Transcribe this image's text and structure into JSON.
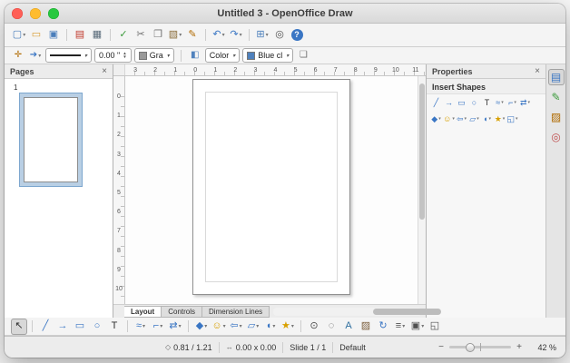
{
  "window": {
    "title": "Untitled 3 - OpenOffice Draw"
  },
  "chrome": {
    "dropdown_glyph": "▾",
    "spin_up": "▲",
    "spin_down": "▼"
  },
  "colors": {
    "accent": "#3a76c4",
    "selection": "#b9cfe4"
  },
  "standard_toolbar": {
    "group1": [
      {
        "name": "new-document-icon",
        "glyph": "▢",
        "color": "#4a7ebb",
        "dropdown": true
      },
      {
        "name": "open-icon",
        "glyph": "▭",
        "color": "#d89b2e"
      },
      {
        "name": "save-icon",
        "glyph": "▣",
        "color": "#4a7ebb"
      }
    ],
    "group2": [
      {
        "name": "export-pdf-icon",
        "glyph": "▤",
        "color": "#c0392b"
      },
      {
        "name": "print-icon",
        "glyph": "▦",
        "color": "#5a6b7a"
      }
    ],
    "group3": [
      {
        "name": "spelling-icon",
        "glyph": "✓",
        "color": "#3a9a3a"
      },
      {
        "name": "cut-icon",
        "glyph": "✂",
        "color": "#707070"
      },
      {
        "name": "copy-icon",
        "glyph": "❐",
        "color": "#707070"
      },
      {
        "name": "paste-icon",
        "glyph": "▧",
        "color": "#8a6d3b",
        "dropdown": true
      },
      {
        "name": "format-paintbrush-icon",
        "glyph": "✎",
        "color": "#b06a00"
      }
    ],
    "group4": [
      {
        "name": "undo-icon",
        "glyph": "↶",
        "color": "#3a76c4",
        "dropdown": true
      },
      {
        "name": "redo-icon",
        "glyph": "↷",
        "color": "#3a76c4",
        "dropdown": true
      }
    ],
    "group5": [
      {
        "name": "insert-table-icon",
        "glyph": "⊞",
        "color": "#4a7ebb",
        "dropdown": true
      },
      {
        "name": "zoom-icon",
        "glyph": "◎",
        "color": "#505050"
      },
      {
        "name": "help-icon",
        "glyph": "?",
        "color": "#ffffff",
        "cls": "help"
      }
    ]
  },
  "line_filling_toolbar": {
    "edit_points_glyph": "✛",
    "arrow_style_glyph": "➔",
    "line_width": "0.00 \"",
    "line_color_label": "Gra",
    "line_color_swatch": "#9a9a9a",
    "area_fill_glyph": "◧",
    "area_style_label": "Color",
    "area_color_label": "Blue cl",
    "area_color_swatch": "#4f81bd",
    "shadow_glyph": "❏"
  },
  "pages_panel": {
    "title": "Pages",
    "close": "×",
    "page_number": "1"
  },
  "rulers": {
    "horizontal": [
      "3",
      "2",
      "1",
      "0",
      "1",
      "2",
      "3",
      "4",
      "5",
      "6",
      "7",
      "8",
      "9",
      "10",
      "11"
    ],
    "vertical": [
      "0",
      "1",
      "2",
      "3",
      "4",
      "5",
      "6",
      "7",
      "8",
      "9",
      "10"
    ]
  },
  "layer_tabs": [
    {
      "label": "Layout",
      "cls": "active"
    },
    {
      "label": "Controls"
    },
    {
      "label": "Dimension Lines"
    }
  ],
  "properties_panel": {
    "title": "Properties",
    "close": "×",
    "insert_shapes": {
      "title": "Insert Shapes",
      "row1": [
        {
          "name": "line-icon",
          "glyph": "╱",
          "color": "#3a76c4"
        },
        {
          "name": "arrow-icon",
          "glyph": "→",
          "color": "#3a76c4"
        },
        {
          "name": "rectangle-icon",
          "glyph": "▭",
          "color": "#3a76c4"
        },
        {
          "name": "ellipse-icon",
          "glyph": "○",
          "color": "#3a76c4"
        },
        {
          "name": "text-box-icon",
          "glyph": "T",
          "color": "#303030"
        },
        {
          "name": "curve-icon",
          "glyph": "≈",
          "color": "#3a76c4",
          "dropdown": true
        },
        {
          "name": "connector-icon",
          "glyph": "⌐",
          "color": "#3a76c4",
          "dropdown": true
        },
        {
          "name": "lines-arrows-icon",
          "glyph": "⇄",
          "color": "#3a76c4",
          "dropdown": true
        }
      ],
      "row2": [
        {
          "name": "basic-shapes-icon",
          "glyph": "◆",
          "color": "#3a76c4",
          "dropdown": true
        },
        {
          "name": "symbol-shapes-icon",
          "glyph": "☺",
          "color": "#d8a000",
          "dropdown": true
        },
        {
          "name": "block-arrows-icon",
          "glyph": "⇦",
          "color": "#3a76c4",
          "dropdown": true
        },
        {
          "name": "flowchart-icon",
          "glyph": "▱",
          "color": "#3a76c4",
          "dropdown": true
        },
        {
          "name": "callouts-icon",
          "glyph": "◖",
          "color": "#3a76c4",
          "dropdown": true
        },
        {
          "name": "stars-icon",
          "glyph": "★",
          "color": "#d8a000",
          "dropdown": true
        },
        {
          "name": "3d-objects-icon",
          "glyph": "◱",
          "color": "#3a76c4",
          "dropdown": true
        }
      ]
    }
  },
  "sidebar_deck": [
    {
      "name": "properties-deck-icon",
      "glyph": "▤",
      "color": "#3a76c4",
      "cls": "active"
    },
    {
      "name": "styles-deck-icon",
      "glyph": "✎",
      "color": "#3a9a3a"
    },
    {
      "name": "gallery-deck-icon",
      "glyph": "▨",
      "color": "#b06a00"
    },
    {
      "name": "navigator-deck-icon",
      "glyph": "◎",
      "color": "#c05050"
    }
  ],
  "drawing_toolbar": {
    "group1": [
      {
        "name": "select-icon",
        "glyph": "↖",
        "color": "#303030",
        "cls": "active"
      }
    ],
    "group2": [
      {
        "name": "line-icon",
        "glyph": "╱",
        "color": "#3a76c4"
      },
      {
        "name": "arrow-icon",
        "glyph": "→",
        "color": "#3a76c4"
      },
      {
        "name": "rectangle-icon",
        "glyph": "▭",
        "color": "#3a76c4"
      },
      {
        "name": "ellipse-icon",
        "glyph": "○",
        "color": "#3a76c4"
      },
      {
        "name": "text-icon",
        "glyph": "T",
        "color": "#303030"
      }
    ],
    "group3": [
      {
        "name": "curve-icon",
        "glyph": "≈",
        "color": "#3a76c4",
        "dropdown": true
      },
      {
        "name": "connector-icon",
        "glyph": "⌐",
        "color": "#3a76c4",
        "dropdown": true
      },
      {
        "name": "lines-arrows-icon",
        "glyph": "⇄",
        "color": "#3a76c4",
        "dropdown": true
      }
    ],
    "group4": [
      {
        "name": "basic-shapes-icon",
        "glyph": "◆",
        "color": "#3a76c4",
        "dropdown": true
      },
      {
        "name": "symbol-shapes-icon",
        "glyph": "☺",
        "color": "#d8a000",
        "dropdown": true
      },
      {
        "name": "block-arrows-icon",
        "glyph": "⇦",
        "color": "#3a76c4",
        "dropdown": true
      },
      {
        "name": "flowchart-icon",
        "glyph": "▱",
        "color": "#3a76c4",
        "dropdown": true
      },
      {
        "name": "callouts-icon",
        "glyph": "◖",
        "color": "#3a76c4",
        "dropdown": true
      },
      {
        "name": "stars-icon",
        "glyph": "★",
        "color": "#d8a000",
        "dropdown": true
      }
    ],
    "group5": [
      {
        "name": "edit-points-icon",
        "glyph": "⊙",
        "color": "#505050"
      },
      {
        "name": "glue-points-icon",
        "glyph": "◌",
        "color": "#505050"
      },
      {
        "name": "fontwork-icon",
        "glyph": "A",
        "color": "#2f6f9f"
      },
      {
        "name": "insert-image-icon",
        "glyph": "▨",
        "color": "#7a5c3a"
      },
      {
        "name": "rotate-icon",
        "glyph": "↻",
        "color": "#3a76c4"
      },
      {
        "name": "align-icon",
        "glyph": "≡",
        "color": "#505050",
        "dropdown": true
      },
      {
        "name": "arrange-icon",
        "glyph": "▣",
        "color": "#505050",
        "dropdown": true
      },
      {
        "name": "extrusion-icon",
        "glyph": "◱",
        "color": "#505050"
      }
    ]
  },
  "status_bar": {
    "position_icon": "◇",
    "position": "0.81 / 1.21",
    "size_icon": "↔",
    "size": "0.00 x 0.00",
    "slide": "Slide 1 / 1",
    "template": "Default",
    "zoom_out": "−",
    "zoom_in": "+",
    "zoom": "42 %"
  }
}
